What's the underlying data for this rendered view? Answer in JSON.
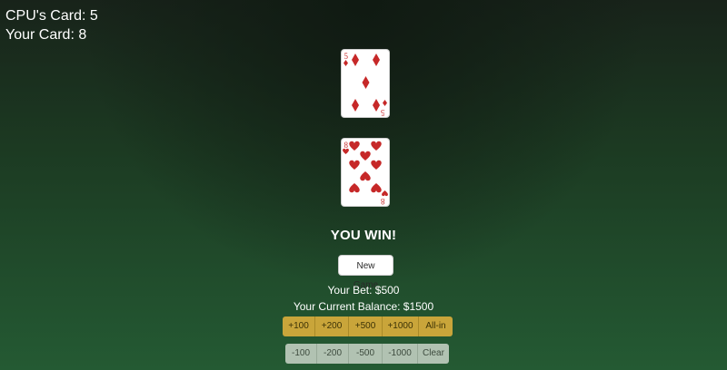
{
  "scoreboard": {
    "cpu_label": "CPU's Card: 5",
    "player_label": "Your Card: 8"
  },
  "cpu_card": {
    "rank": "5",
    "suit": "diamonds",
    "icon": "diamond-suit-icon",
    "color": "#c62828"
  },
  "player_card": {
    "rank": "8",
    "suit": "hearts",
    "icon": "heart-suit-icon",
    "color": "#c62828"
  },
  "result_text": "YOU WIN!",
  "new_game_label": "New Game",
  "bet_text": "Your Bet: $500",
  "balance_text": "Your Current Balance: $1500",
  "add_buttons": [
    "+100",
    "+200",
    "+500",
    "+1000",
    "All-in"
  ],
  "subtract_buttons": [
    "-100",
    "-200",
    "-500",
    "-1000",
    "Clear"
  ],
  "colors": {
    "table_green": "#245a33",
    "add_button": "#c9a53a",
    "subtract_button": "#b1c2b2",
    "suit_red": "#c62828"
  }
}
